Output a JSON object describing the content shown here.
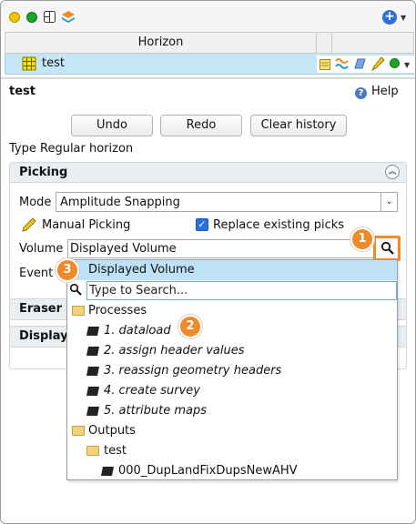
{
  "toolbar": {
    "icons": [
      "yellow-status-icon",
      "green-status-icon",
      "layout-icon",
      "layers-icon",
      "add-icon"
    ]
  },
  "table": {
    "column_header": "Horizon",
    "row": {
      "label": "test"
    }
  },
  "panel": {
    "title": "test",
    "help_label": "Help",
    "undo_label": "Undo",
    "redo_label": "Redo",
    "clear_history_label": "Clear history",
    "type_label": "Type",
    "type_value": "Regular horizon"
  },
  "picking": {
    "header": "Picking",
    "mode_label": "Mode",
    "mode_value": "Amplitude Snapping",
    "manual_picking_label": "Manual Picking",
    "replace_label": "Replace existing picks",
    "replace_checked": true,
    "volume_label": "Volume",
    "volume_value": "Displayed Volume",
    "event_label": "Event"
  },
  "sections": {
    "eraser": "Eraser",
    "display": "Display"
  },
  "dropdown": {
    "selected": "Displayed Volume",
    "search_placeholder": "Type to Search...",
    "items": [
      {
        "type": "folder",
        "label": "Processes"
      },
      {
        "type": "volume",
        "label": "1. dataload"
      },
      {
        "type": "volume",
        "label": "2. assign header values"
      },
      {
        "type": "volume",
        "label": "3. reassign geometry headers"
      },
      {
        "type": "volume",
        "label": "4. create survey"
      },
      {
        "type": "volume",
        "label": "5. attribute maps"
      },
      {
        "type": "folder",
        "label": "Outputs"
      },
      {
        "type": "folder",
        "label": "test"
      },
      {
        "type": "volume",
        "label": "000_DupLandFixDupsNewAHV"
      }
    ]
  },
  "callouts": [
    "1",
    "2",
    "3"
  ],
  "colors": {
    "accent": "#ef8a2a",
    "selection": "#bfe1f7",
    "row_highlight": "#c5e6f6"
  }
}
